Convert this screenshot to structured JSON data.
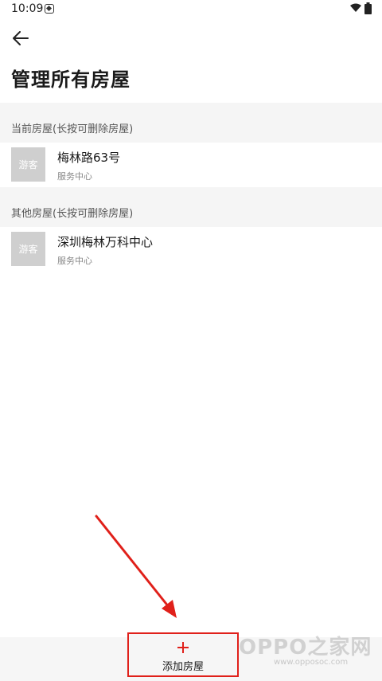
{
  "status_bar": {
    "time": "10:09"
  },
  "header": {
    "title": "管理所有房屋"
  },
  "sections": {
    "current": {
      "label": "当前房屋(长按可删除房屋)",
      "houses": [
        {
          "avatar": "游客",
          "name": "梅林路63号",
          "sub": "服务中心"
        }
      ]
    },
    "other": {
      "label": "其他房屋(长按可删除房屋)",
      "houses": [
        {
          "avatar": "游客",
          "name": "深圳梅林万科中心",
          "sub": "服务中心"
        }
      ]
    }
  },
  "bottom": {
    "add_label": "添加房屋"
  },
  "watermark": {
    "text": "OPPO之家网",
    "sub": "www.opposoc.com"
  },
  "colors": {
    "accent": "#e0201a",
    "section_bg": "#f5f5f5",
    "avatar_bg": "#cfcfcf"
  }
}
